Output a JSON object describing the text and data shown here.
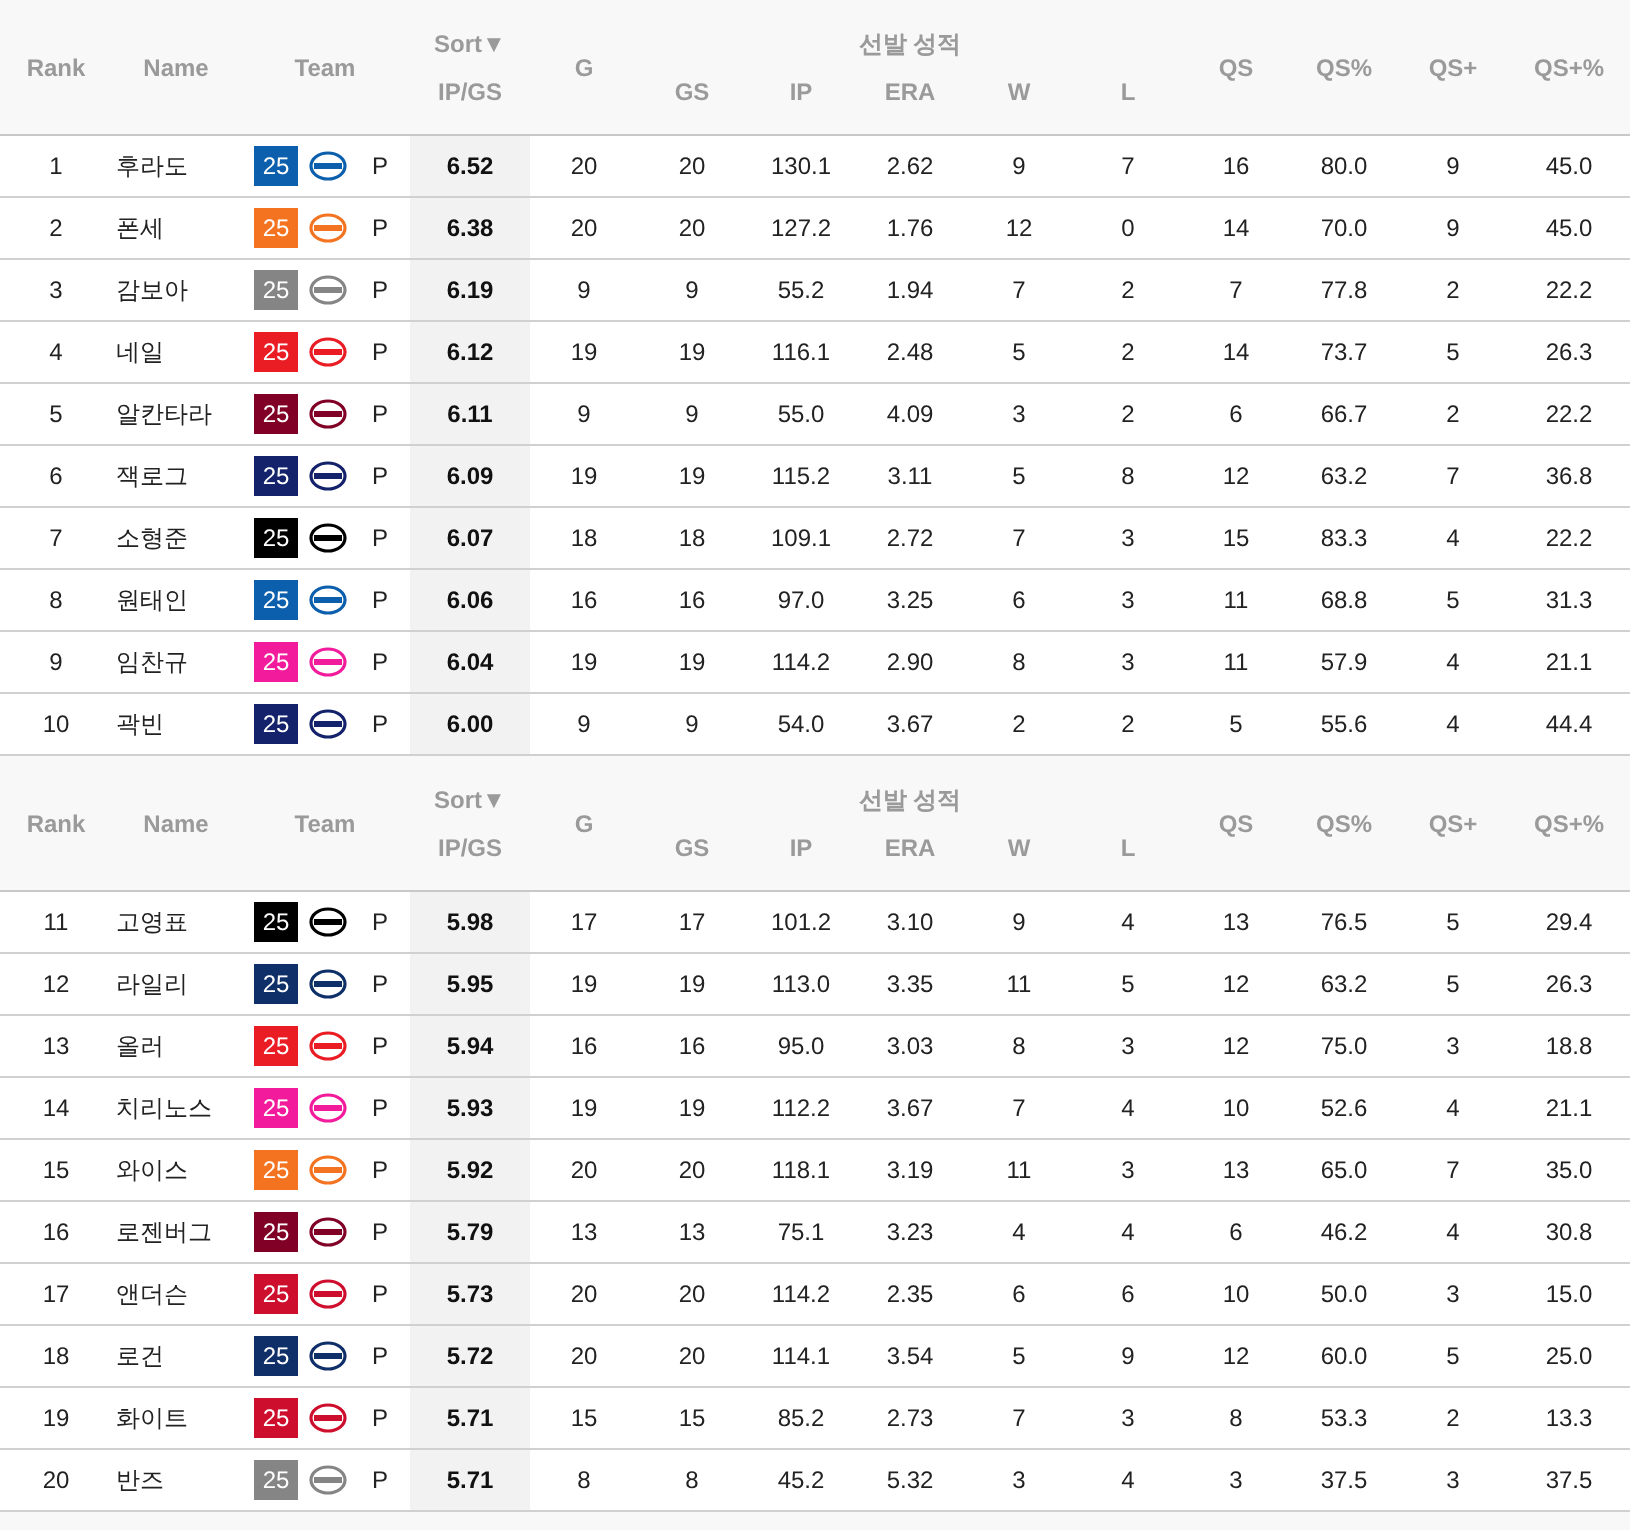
{
  "tables": [
    {
      "header": {
        "rank": "Rank",
        "name": "Name",
        "team": "Team",
        "sort": "Sort▼",
        "ip_gs": "IP/GS",
        "g": "G",
        "group": "선발 성적",
        "group_columns": [
          "GS",
          "IP",
          "ERA",
          "W",
          "L"
        ],
        "tail_columns": [
          "QS",
          "QS%",
          "QS+",
          "QS+%"
        ]
      },
      "rows": [
        {
          "rank": "1",
          "name": "후라도",
          "badge": "25",
          "color": "#0b5fac",
          "position": "P",
          "ip_gs": "6.52",
          "stats": [
            "20",
            "20",
            "130.1",
            "2.62",
            "9",
            "7",
            "16",
            "80.0",
            "9",
            "45.0"
          ]
        },
        {
          "rank": "2",
          "name": "폰세",
          "badge": "25",
          "color": "#f37321",
          "position": "P",
          "ip_gs": "6.38",
          "stats": [
            "20",
            "20",
            "127.2",
            "1.76",
            "12",
            "0",
            "14",
            "70.0",
            "9",
            "45.0"
          ]
        },
        {
          "rank": "3",
          "name": "감보아",
          "badge": "25",
          "color": "#858585",
          "position": "P",
          "ip_gs": "6.19",
          "stats": [
            "9",
            "9",
            "55.2",
            "1.94",
            "7",
            "2",
            "7",
            "77.8",
            "2",
            "22.2"
          ]
        },
        {
          "rank": "4",
          "name": "네일",
          "badge": "25",
          "color": "#ea1c24",
          "position": "P",
          "ip_gs": "6.12",
          "stats": [
            "19",
            "19",
            "116.1",
            "2.48",
            "5",
            "2",
            "14",
            "73.7",
            "5",
            "26.3"
          ]
        },
        {
          "rank": "5",
          "name": "알칸타라",
          "badge": "25",
          "color": "#800026",
          "position": "P",
          "ip_gs": "6.11",
          "stats": [
            "9",
            "9",
            "55.0",
            "4.09",
            "3",
            "2",
            "6",
            "66.7",
            "2",
            "22.2"
          ]
        },
        {
          "rank": "6",
          "name": "잭로그",
          "badge": "25",
          "color": "#13226b",
          "position": "P",
          "ip_gs": "6.09",
          "stats": [
            "19",
            "19",
            "115.2",
            "3.11",
            "5",
            "8",
            "12",
            "63.2",
            "7",
            "36.8"
          ]
        },
        {
          "rank": "7",
          "name": "소형준",
          "badge": "25",
          "color": "#000000",
          "position": "P",
          "ip_gs": "6.07",
          "stats": [
            "18",
            "18",
            "109.1",
            "2.72",
            "7",
            "3",
            "15",
            "83.3",
            "4",
            "22.2"
          ]
        },
        {
          "rank": "8",
          "name": "원태인",
          "badge": "25",
          "color": "#0b5fac",
          "position": "P",
          "ip_gs": "6.06",
          "stats": [
            "16",
            "16",
            "97.0",
            "3.25",
            "6",
            "3",
            "11",
            "68.8",
            "5",
            "31.3"
          ]
        },
        {
          "rank": "9",
          "name": "임찬규",
          "badge": "25",
          "color": "#f21b9c",
          "position": "P",
          "ip_gs": "6.04",
          "stats": [
            "19",
            "19",
            "114.2",
            "2.90",
            "8",
            "3",
            "11",
            "57.9",
            "4",
            "21.1"
          ]
        },
        {
          "rank": "10",
          "name": "곽빈",
          "badge": "25",
          "color": "#13226b",
          "position": "P",
          "ip_gs": "6.00",
          "stats": [
            "9",
            "9",
            "54.0",
            "3.67",
            "2",
            "2",
            "5",
            "55.6",
            "4",
            "44.4"
          ]
        }
      ]
    },
    {
      "header": {
        "rank": "Rank",
        "name": "Name",
        "team": "Team",
        "sort": "Sort▼",
        "ip_gs": "IP/GS",
        "g": "G",
        "group": "선발 성적",
        "group_columns": [
          "GS",
          "IP",
          "ERA",
          "W",
          "L"
        ],
        "tail_columns": [
          "QS",
          "QS%",
          "QS+",
          "QS+%"
        ]
      },
      "rows": [
        {
          "rank": "11",
          "name": "고영표",
          "badge": "25",
          "color": "#000000",
          "position": "P",
          "ip_gs": "5.98",
          "stats": [
            "17",
            "17",
            "101.2",
            "3.10",
            "9",
            "4",
            "13",
            "76.5",
            "5",
            "29.4"
          ]
        },
        {
          "rank": "12",
          "name": "라일리",
          "badge": "25",
          "color": "#0f2f68",
          "position": "P",
          "ip_gs": "5.95",
          "stats": [
            "19",
            "19",
            "113.0",
            "3.35",
            "11",
            "5",
            "12",
            "63.2",
            "5",
            "26.3"
          ]
        },
        {
          "rank": "13",
          "name": "올러",
          "badge": "25",
          "color": "#ea1c24",
          "position": "P",
          "ip_gs": "5.94",
          "stats": [
            "16",
            "16",
            "95.0",
            "3.03",
            "8",
            "3",
            "12",
            "75.0",
            "3",
            "18.8"
          ]
        },
        {
          "rank": "14",
          "name": "치리노스",
          "badge": "25",
          "color": "#f21b9c",
          "position": "P",
          "ip_gs": "5.93",
          "stats": [
            "19",
            "19",
            "112.2",
            "3.67",
            "7",
            "4",
            "10",
            "52.6",
            "4",
            "21.1"
          ]
        },
        {
          "rank": "15",
          "name": "와이스",
          "badge": "25",
          "color": "#f37321",
          "position": "P",
          "ip_gs": "5.92",
          "stats": [
            "20",
            "20",
            "118.1",
            "3.19",
            "11",
            "3",
            "13",
            "65.0",
            "7",
            "35.0"
          ]
        },
        {
          "rank": "16",
          "name": "로젠버그",
          "badge": "25",
          "color": "#800026",
          "position": "P",
          "ip_gs": "5.79",
          "stats": [
            "13",
            "13",
            "75.1",
            "3.23",
            "4",
            "4",
            "6",
            "46.2",
            "4",
            "30.8"
          ]
        },
        {
          "rank": "17",
          "name": "앤더슨",
          "badge": "25",
          "color": "#ce0e2d",
          "position": "P",
          "ip_gs": "5.73",
          "stats": [
            "20",
            "20",
            "114.2",
            "2.35",
            "6",
            "6",
            "10",
            "50.0",
            "3",
            "15.0"
          ]
        },
        {
          "rank": "18",
          "name": "로건",
          "badge": "25",
          "color": "#0f2f68",
          "position": "P",
          "ip_gs": "5.72",
          "stats": [
            "20",
            "20",
            "114.1",
            "3.54",
            "5",
            "9",
            "12",
            "60.0",
            "5",
            "25.0"
          ]
        },
        {
          "rank": "19",
          "name": "화이트",
          "badge": "25",
          "color": "#ce0e2d",
          "position": "P",
          "ip_gs": "5.71",
          "stats": [
            "15",
            "15",
            "85.2",
            "2.73",
            "7",
            "3",
            "8",
            "53.3",
            "2",
            "13.3"
          ]
        },
        {
          "rank": "20",
          "name": "반즈",
          "badge": "25",
          "color": "#858585",
          "position": "P",
          "ip_gs": "5.71",
          "stats": [
            "8",
            "8",
            "45.2",
            "5.32",
            "3",
            "4",
            "3",
            "37.5",
            "3",
            "37.5"
          ]
        }
      ]
    }
  ]
}
